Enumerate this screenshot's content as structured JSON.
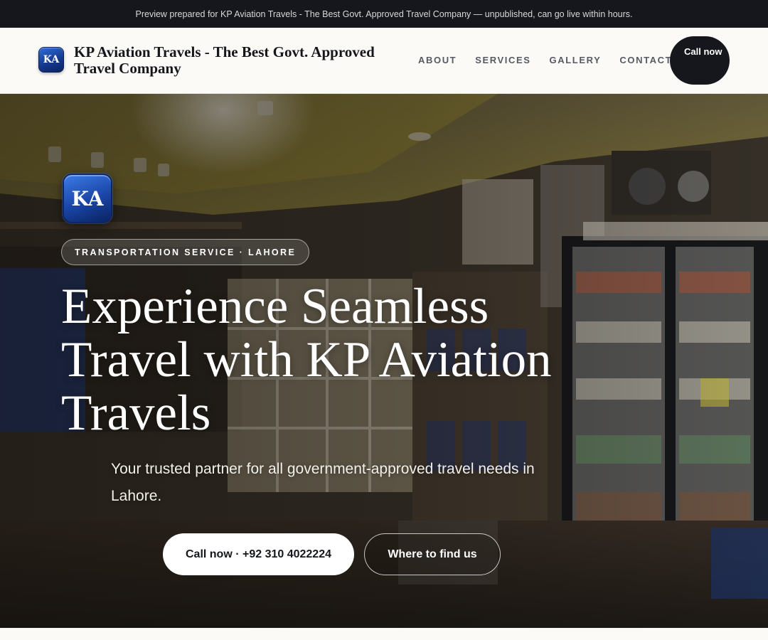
{
  "preview_banner": "Preview prepared for KP Aviation Travels - The Best Govt. Approved Travel Company — unpublished, can go live within hours.",
  "header": {
    "logo_initials": "KA",
    "brand_name": "KP Aviation Travels - The Best Govt. Approved Travel Company",
    "nav": [
      "ABOUT",
      "SERVICES",
      "GALLERY",
      "CONTACT"
    ],
    "call_button": "Call now"
  },
  "hero": {
    "logo_initials": "KA",
    "category_pill": "TRANSPORTATION SERVICE · LAHORE",
    "title": "Experience Seamless Travel with KP Aviation Travels",
    "subtitle": "Your trusted partner for all government-approved travel needs in Lahore.",
    "primary_cta": "Call now · +92 310 4022224",
    "secondary_cta": "Where to find us",
    "background_image": "shop-interior-photo"
  },
  "colors": {
    "dark": "#15171c",
    "brand_blue": "#1a44a6",
    "page_bg": "#fbfaf7",
    "nav_text": "#555a63"
  },
  "icons": {
    "brand_logo": "ka-monogram-icon"
  }
}
